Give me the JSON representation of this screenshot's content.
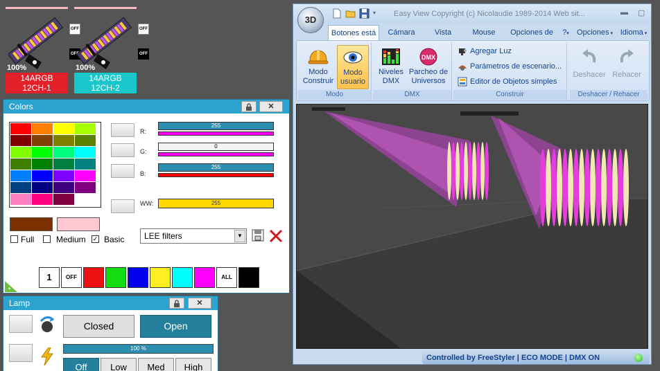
{
  "fixtures": [
    {
      "label_line1": "14ARGB",
      "label_line2": "12CH-1",
      "percent": "100%",
      "label_color": "#e3202a",
      "switch_top": "OFF",
      "switch_bottom": "OFF"
    },
    {
      "label_line1": "14ARGB",
      "label_line2": "12CH-2",
      "percent": "100%",
      "label_color": "#19c7cb",
      "switch_top": "OFF",
      "switch_bottom": "OFF"
    }
  ],
  "colors_panel": {
    "title": "Colors",
    "palette": [
      [
        "#ff0000",
        "#ff8000",
        "#ffff00",
        "#a8ff00"
      ],
      [
        "#800000",
        "#804000",
        "#808000",
        "#5a8000"
      ],
      [
        "#80ff00",
        "#00ff00",
        "#00ff80",
        "#00ffff"
      ],
      [
        "#408000",
        "#008000",
        "#008040",
        "#008080"
      ],
      [
        "#0080ff",
        "#0000ff",
        "#8000ff",
        "#ff00ff"
      ],
      [
        "#004080",
        "#000080",
        "#400080",
        "#800080"
      ],
      [
        "#ff80c0",
        "#ff0080",
        "#800040",
        "#ffffff"
      ]
    ],
    "preview_colors": [
      "#7a3000",
      "#ffc8d2"
    ],
    "channels": [
      {
        "label": "R:",
        "value": "255",
        "color": "#ff00ff"
      },
      {
        "label": "G:",
        "value": "0",
        "color": "#ff00ff"
      },
      {
        "label": "B:",
        "value": "255",
        "color": "#ff0000"
      },
      {
        "label": "WW:",
        "value": "255",
        "color": "#ffd800"
      }
    ],
    "filters": {
      "full": "Full",
      "medium": "Medium",
      "basic": "Basic",
      "basic_checked": "✓"
    },
    "gel_select": "LEE filters",
    "quick_buttons": [
      {
        "label": "1",
        "color": "#ffffff"
      },
      {
        "label": "OFF",
        "color": "#ffffff"
      },
      {
        "label": "",
        "color": "#ee1111"
      },
      {
        "label": "",
        "color": "#11dd11"
      },
      {
        "label": "",
        "color": "#0000ee"
      },
      {
        "label": "",
        "color": "#ffee22"
      },
      {
        "label": "",
        "color": "#00ffff"
      },
      {
        "label": "",
        "color": "#ff00ff"
      },
      {
        "label": "ALL",
        "color": "#ffffff"
      },
      {
        "label": "",
        "color": "#000000"
      }
    ]
  },
  "lamp_panel": {
    "title": "Lamp",
    "closed": "Closed",
    "open": "Open",
    "dimmer": "100 %",
    "dimmer_fraction": 1.0,
    "levels": [
      "Off",
      "Low",
      "Med",
      "High"
    ]
  },
  "window": {
    "title": "Easy View   Copyright (c) Nicolaudie 1989-2014   Web sit...",
    "orb_text": "3D",
    "tabs": [
      "Botones está",
      "Cámara",
      "Vista",
      "Mouse",
      "Opciones de",
      "?",
      "Opciones",
      "Idioma"
    ],
    "groups": {
      "modo": {
        "label": "Modo",
        "btn1_l1": "Modo",
        "btn1_l2": "Construir",
        "btn2_l1": "Modo",
        "btn2_l2": "usuario"
      },
      "dmx": {
        "label": "DMX",
        "btn1_l1": "Niveles",
        "btn1_l2": "DMX",
        "btn2_l1": "Parcheo de",
        "btn2_l2": "Universos",
        "dmx_icon_text": "DMX"
      },
      "construir": {
        "label": "Construir",
        "items": [
          "Agregar Luz",
          "Parámetros de escenario...",
          "Editor de Objetos simples"
        ]
      },
      "undo": {
        "label": "Deshacer / Rehacer",
        "undo": "Deshacer",
        "redo": "Rehacer"
      }
    },
    "status": "Controlled by FreeStyler  |  ECO MODE  |  DMX ON"
  },
  "colors": {
    "accent": "#2ba4cf",
    "window_frame": "#c9dcef",
    "beam": "#e040e8",
    "slab_pink": "#e83ce0",
    "slab_cream": "#f1e6b4"
  }
}
